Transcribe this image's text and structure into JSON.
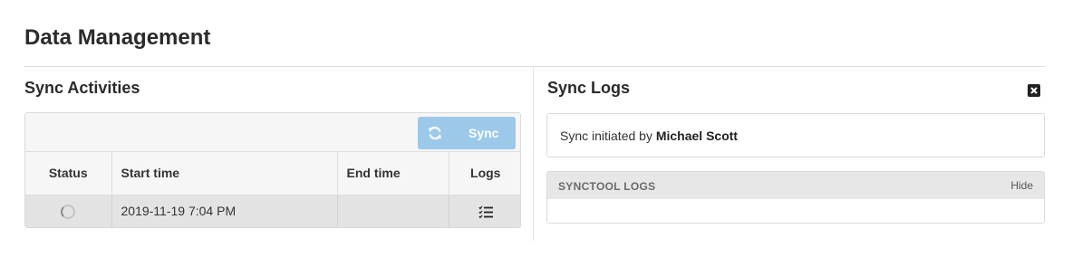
{
  "page": {
    "title": "Data Management"
  },
  "activities": {
    "title": "Sync Activities",
    "sync_button": {
      "label": "Sync",
      "icon": "refresh-icon",
      "color": "#9cc9ea"
    },
    "columns": [
      "Status",
      "Start time",
      "End time",
      "Logs"
    ],
    "rows": [
      {
        "status": "in-progress",
        "start_time": "2019-11-19 7:04 PM",
        "end_time": "",
        "logs_icon": "checklist-icon"
      }
    ]
  },
  "logs": {
    "title": "Sync Logs",
    "close_icon": "close-icon",
    "initiated_prefix": "Sync initiated by",
    "initiated_user": "Michael Scott",
    "synctool": {
      "title": "SYNCTOOL LOGS",
      "toggle_label": "Hide"
    }
  }
}
